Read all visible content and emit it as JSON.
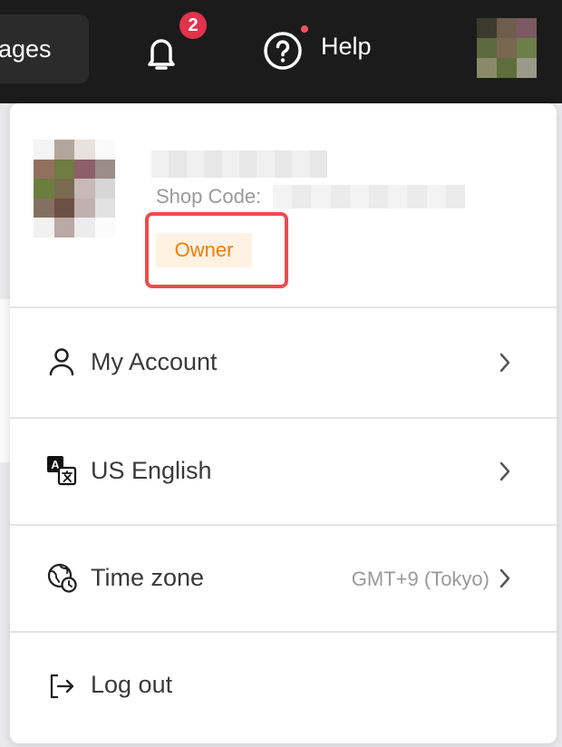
{
  "topbar": {
    "pages_label": "ages",
    "notifications_count": "2",
    "help_label": "Help"
  },
  "profile": {
    "shop_code_label": "Shop Code:",
    "role_badge": "Owner"
  },
  "menu": {
    "my_account": "My Account",
    "language": "US English",
    "time_zone": "Time zone",
    "time_zone_value": "GMT+9 (Tokyo)",
    "log_out": "Log out"
  },
  "colors": {
    "topbar_bg": "#1b1b1b",
    "badge_red": "#e0334c",
    "owner_text": "#f57c00",
    "owner_bg": "#fff2e3",
    "highlight_frame": "#ef4b4b"
  }
}
